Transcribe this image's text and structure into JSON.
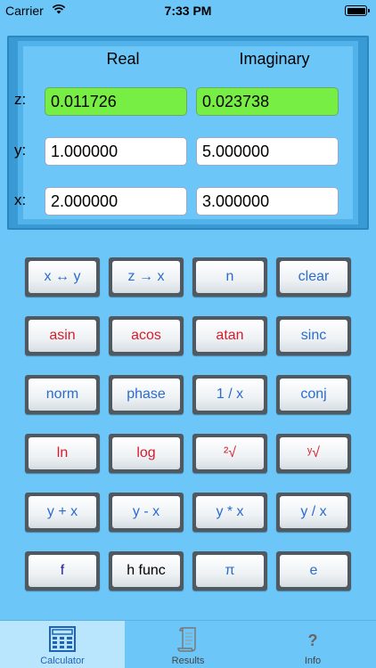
{
  "status_bar": {
    "carrier": "Carrier",
    "time": "7:33 PM"
  },
  "display": {
    "headers": {
      "real": "Real",
      "imaginary": "Imaginary"
    },
    "rows": [
      {
        "label": "z:",
        "real": "0.011726",
        "imag": "0.023738"
      },
      {
        "label": "y:",
        "real": "1.000000",
        "imag": "5.000000"
      },
      {
        "label": "x:",
        "real": "2.000000",
        "imag": "3.000000"
      }
    ]
  },
  "keys": [
    [
      "x ↔ y",
      "z → x",
      "n",
      "clear"
    ],
    [
      "asin",
      "acos",
      "atan",
      "sinc"
    ],
    [
      "norm",
      "phase",
      "1 / x",
      "conj"
    ],
    [
      "ln",
      "log",
      "²√",
      "ʸ√"
    ],
    [
      "y + x",
      "y - x",
      "y * x",
      "y / x"
    ],
    [
      "f",
      "h func",
      "π",
      "e"
    ]
  ],
  "key_colors": [
    [
      "blue",
      "blue",
      "blue",
      "blue"
    ],
    [
      "red",
      "red",
      "red",
      "blue"
    ],
    [
      "blue",
      "blue",
      "blue",
      "blue"
    ],
    [
      "red",
      "red",
      "red",
      "red"
    ],
    [
      "blue",
      "blue",
      "blue",
      "blue"
    ],
    [
      "navy",
      "black",
      "blue",
      "blue"
    ]
  ],
  "tabs": [
    {
      "label": "Calculator",
      "icon": "calculator-icon",
      "active": true
    },
    {
      "label": "Results",
      "icon": "scroll-icon",
      "active": false
    },
    {
      "label": "Info",
      "icon": "question-icon",
      "active": false
    }
  ],
  "colors": {
    "background": "#6cc7f8",
    "highlight_field": "#77ee44",
    "key_text_blue": "#2a6cd0",
    "key_text_red": "#d81b2b"
  }
}
